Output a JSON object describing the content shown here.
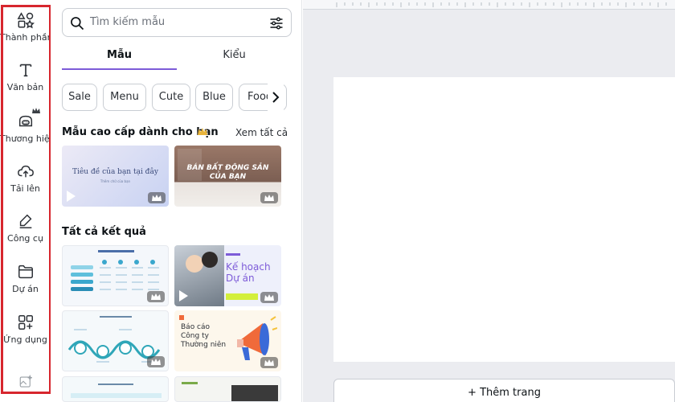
{
  "rail": {
    "items": [
      {
        "label": "Thành phần",
        "icon": "elements-icon"
      },
      {
        "label": "Văn bản",
        "icon": "text-icon"
      },
      {
        "label": "Thương hiệu",
        "icon": "brand-icon"
      },
      {
        "label": "Tải lên",
        "icon": "upload-icon"
      },
      {
        "label": "Công cụ",
        "icon": "draw-icon"
      },
      {
        "label": "Dự án",
        "icon": "folder-icon"
      },
      {
        "label": "Ứng dụng",
        "icon": "apps-icon"
      }
    ],
    "highlight_color": "#d7262e"
  },
  "panel": {
    "search": {
      "placeholder": "Tìm kiếm mẫu"
    },
    "tabs": [
      {
        "label": "Mẫu",
        "active": true
      },
      {
        "label": "Kiểu",
        "active": false
      }
    ],
    "chips": [
      "Sale",
      "Menu",
      "Cute",
      "Blue",
      "Food"
    ],
    "premium_section": {
      "title": "Mẫu cao cấp dành cho bạn",
      "see_all": "Xem tất cả"
    },
    "premium_thumbs": [
      {
        "title": "Tiêu đề của bạn tại đây",
        "subtitle": "Thêm chữ của bạn",
        "bg": "#dfe3f6"
      },
      {
        "title": "BÁN BẤT ĐỘNG SẢN CỦA BẠN",
        "bg": "#8a6b5c"
      }
    ],
    "all_results": {
      "title": "Tất cả kết quả"
    },
    "result_thumbs": [
      {
        "title": "Kế hoạch Dự án",
        "bg": "#e9ecf8"
      },
      {
        "title": "Báo cáo Công ty Thường niên",
        "bg": "#fdf7ec"
      }
    ]
  },
  "canvas": {
    "add_page_label": "+ Thêm trang"
  },
  "colors": {
    "accent": "#7d5bd8",
    "crown": "#e8b43c"
  }
}
